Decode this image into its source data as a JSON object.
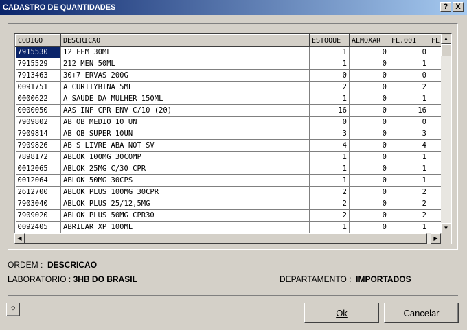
{
  "window": {
    "title": "CADASTRO DE QUANTIDADES",
    "help_btn": "?",
    "close_btn": "X"
  },
  "grid": {
    "columns": [
      "CODIGO",
      "DESCRICAO",
      "ESTOQUE",
      "ALMOXAR",
      "FL.001",
      "FL"
    ],
    "rows": [
      [
        "7915530",
        "12 FEM 30ML",
        "1",
        "0",
        "0"
      ],
      [
        "7915529",
        "212 MEN 50ML",
        "1",
        "0",
        "1"
      ],
      [
        "7913463",
        "30+7 ERVAS 200G",
        "0",
        "0",
        "0"
      ],
      [
        "0091751",
        "A CURITYBINA 5ML",
        "2",
        "0",
        "2"
      ],
      [
        "0000622",
        "A SAUDE DA MULHER 150ML",
        "1",
        "0",
        "1"
      ],
      [
        "0000050",
        "AAS INF CPR ENV C/10 (20)",
        "16",
        "0",
        "16"
      ],
      [
        "7909802",
        "AB OB MEDIO 10 UN",
        "0",
        "0",
        "0"
      ],
      [
        "7909814",
        "AB OB SUPER 10UN",
        "3",
        "0",
        "3"
      ],
      [
        "7909826",
        "AB S LIVRE ABA NOT SV",
        "4",
        "0",
        "4"
      ],
      [
        "7898172",
        "ABLOK 100MG 30COMP",
        "1",
        "0",
        "1"
      ],
      [
        "0012065",
        "ABLOK 25MG C/30 CPR",
        "1",
        "0",
        "1"
      ],
      [
        "0012064",
        "ABLOK 50MG 30CPS",
        "1",
        "0",
        "1"
      ],
      [
        "2612700",
        "ABLOK PLUS 100MG 30CPR",
        "2",
        "0",
        "2"
      ],
      [
        "7903040",
        "ABLOK PLUS 25/12,5MG",
        "2",
        "0",
        "2"
      ],
      [
        "7909020",
        "ABLOK PLUS 50MG CPR30",
        "2",
        "0",
        "2"
      ],
      [
        "0092405",
        "ABRILAR XP 100ML",
        "1",
        "0",
        "1"
      ]
    ]
  },
  "info": {
    "ordem_label": "ORDEM :",
    "ordem_value": "DESCRICAO",
    "laboratorio_label": "LABORATORIO :",
    "laboratorio_value": "3HB DO BRASIL",
    "departamento_label": "DEPARTAMENTO :",
    "departamento_value": "IMPORTADOS"
  },
  "buttons": {
    "help": "?",
    "ok": "Ok",
    "cancel": "Cancelar"
  }
}
